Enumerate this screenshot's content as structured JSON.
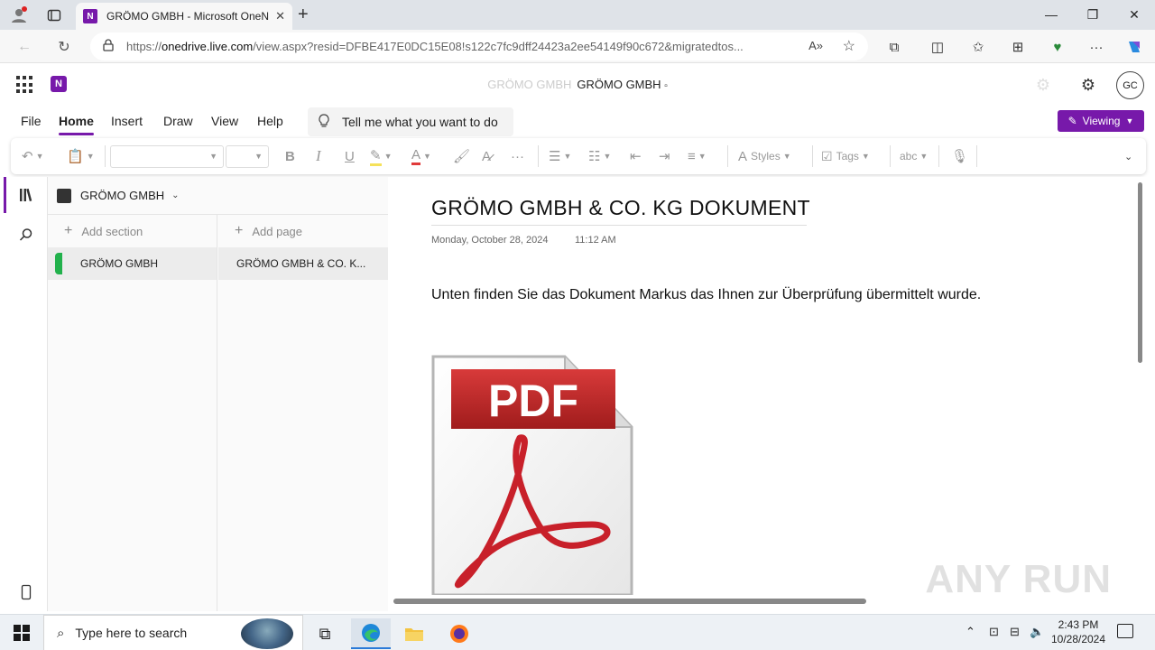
{
  "browser": {
    "tab_title": "GRÖMO GMBH - Microsoft OneNote",
    "tab_favicon": "N",
    "url_domain": "onedrive.live.com",
    "url_prefix": "https://",
    "url_rest": "/view.aspx?resid=DFBE417E0DC15E08!s122c7fc9dff24423a2ee54149f90c672&migratedtos..."
  },
  "app": {
    "title_faded": "GRÖMO GMBH",
    "title": "GRÖMO GMBH",
    "avatar": "GC",
    "logo": "N"
  },
  "menu": {
    "items": [
      "File",
      "Home",
      "Insert",
      "Draw",
      "View",
      "Help"
    ],
    "active": "Home",
    "tellme": "Tell me what you want to do",
    "viewing": "Viewing"
  },
  "ribbon": {
    "bold": "B",
    "italic": "I",
    "underline": "U",
    "styles": "Styles",
    "tags": "Tags",
    "spell": "abc"
  },
  "notebook": {
    "name": "GRÖMO GMBH",
    "add_section": "Add section",
    "add_page": "Add page",
    "section": "GRÖMO GMBH",
    "section_color": "#22b14c",
    "page": "GRÖMO GMBH & CO. K..."
  },
  "page": {
    "title": "GRÖMO GMBH & CO. KG DOKUMENT",
    "date": "Monday, October 28, 2024",
    "time": "11:12 AM",
    "body": "Unten finden Sie das Dokument Markus das Ihnen zur Überprüfung übermittelt wurde.",
    "pdf_label": "PDF"
  },
  "watermark": "ANY RUN",
  "taskbar": {
    "search_placeholder": "Type here to search",
    "time": "2:43 PM",
    "date": "10/28/2024"
  },
  "colors": {
    "accent": "#7719aa",
    "pdf_red": "#c8202a"
  }
}
